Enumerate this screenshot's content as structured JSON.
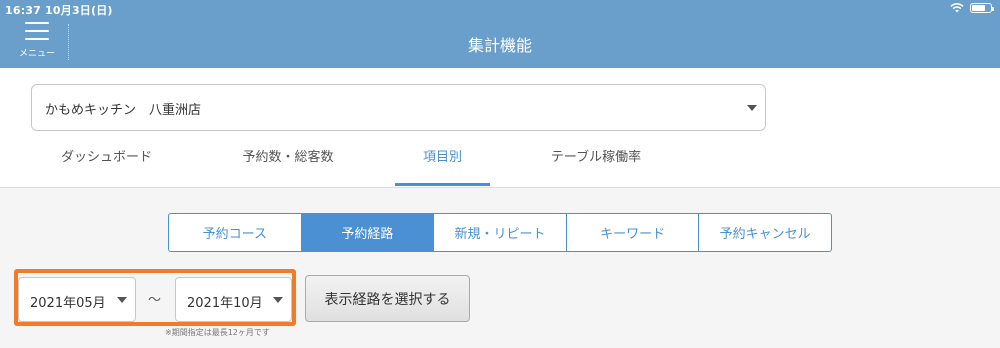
{
  "status_bar": {
    "time_date": "16:37   10月3日(日)",
    "wifi_icon": "wifi-icon",
    "battery_icon": "battery-icon"
  },
  "header": {
    "menu_label": "メニュー",
    "menu_icon": "hamburger-icon",
    "title": "集計機能",
    "background_color": "#6a9fcb"
  },
  "store_select": {
    "value": "かもめキッチン　八重洲店"
  },
  "tabs": [
    {
      "label": "ダッシュボード",
      "active": false
    },
    {
      "label": "予約数・総客数",
      "active": false
    },
    {
      "label": "項目別",
      "active": true
    },
    {
      "label": "テーブル稼働率",
      "active": false
    }
  ],
  "segments": [
    {
      "label": "予約コース",
      "active": false
    },
    {
      "label": "予約経路",
      "active": true
    },
    {
      "label": "新規・リピート",
      "active": false
    },
    {
      "label": "キーワード",
      "active": false
    },
    {
      "label": "予約キャンセル",
      "active": false
    }
  ],
  "period": {
    "from": "2021年05月",
    "separator": "〜",
    "to": "2021年10月",
    "highlight_color": "#f07c2a",
    "note": "※期間指定は最長12ヶ月です"
  },
  "route_button": {
    "label": "表示経路を選択する"
  },
  "accent_color": "#4a90d2"
}
